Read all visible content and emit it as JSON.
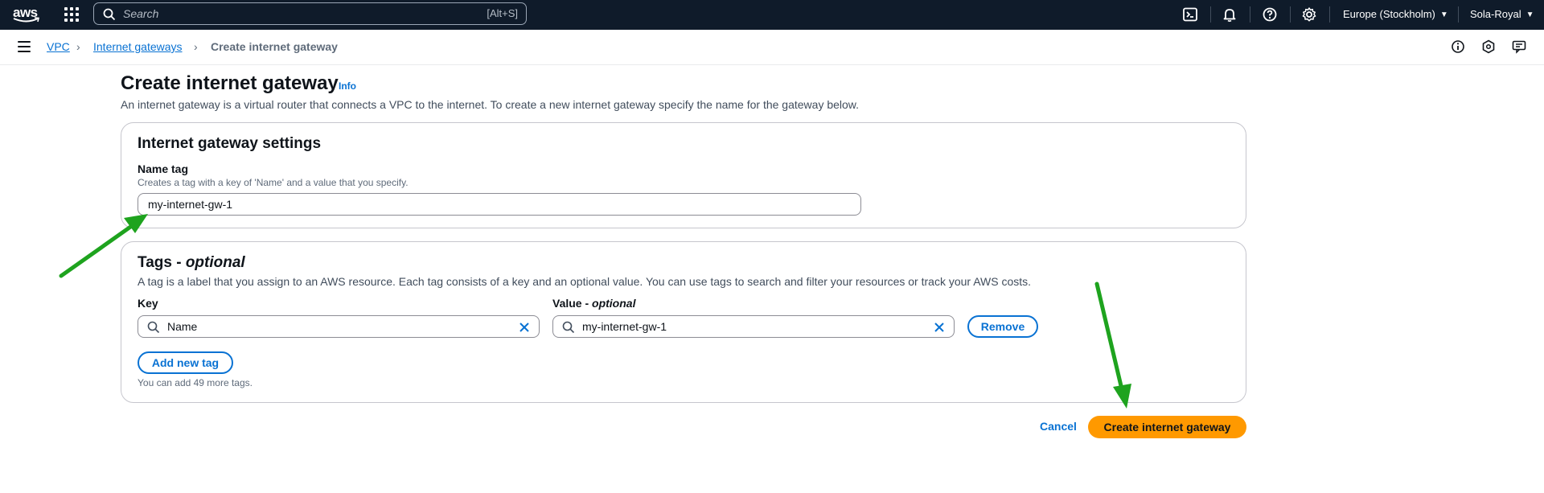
{
  "topnav": {
    "logo_text": "aws",
    "search_placeholder": "Search",
    "search_shortcut": "[Alt+S]",
    "region": "Europe (Stockholm)",
    "account": "Sola-Royal",
    "icons": [
      "cloudshell-icon",
      "notifications-icon",
      "help-icon",
      "settings-icon"
    ]
  },
  "breadcrumb": {
    "items": [
      "VPC",
      "Internet gateways",
      "Create internet gateway"
    ]
  },
  "page": {
    "title": "Create internet gateway",
    "info": "Info",
    "description": "An internet gateway is a virtual router that connects a VPC to the internet. To create a new internet gateway specify the name for the gateway below."
  },
  "settings": {
    "title": "Internet gateway settings",
    "name_label": "Name tag",
    "name_desc": "Creates a tag with a key of 'Name' and a value that you specify.",
    "name_value": "my-internet-gw-1"
  },
  "tags": {
    "title": "Tags - ",
    "title_optional": "optional",
    "description": "A tag is a label that you assign to an AWS resource. Each tag consists of a key and an optional value. You can use tags to search and filter your resources or track your AWS costs.",
    "key_label": "Key",
    "value_label": "Value - ",
    "value_label_optional": "optional",
    "key_value": "Name",
    "value_value": "my-internet-gw-1",
    "remove_label": "Remove",
    "add_label": "Add new tag",
    "hint": "You can add 49 more tags."
  },
  "actions": {
    "cancel": "Cancel",
    "create": "Create internet gateway"
  },
  "colors": {
    "accent": "#0972d3",
    "primary_button": "#ff9900",
    "topnav_bg": "#0f1b2a",
    "annotation_arrow": "#1ea31e"
  }
}
